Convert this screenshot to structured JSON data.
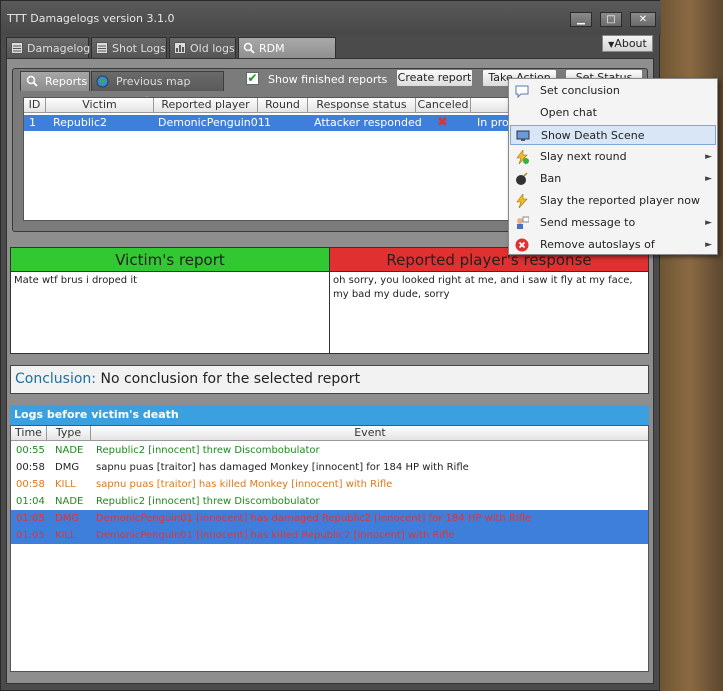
{
  "window": {
    "title": "TTT Damagelogs version 3.1.0",
    "about_label": "About",
    "min_glyph": "▁",
    "max_glyph": "□",
    "close_glyph": "✕"
  },
  "main_tabs": [
    {
      "label": "Damagelog",
      "icon": "list-icon"
    },
    {
      "label": "Shot Logs",
      "icon": "list-icon"
    },
    {
      "label": "Old logs",
      "icon": "chart-icon"
    },
    {
      "label": "RDM Manager",
      "icon": "search-icon",
      "active": true
    }
  ],
  "report_tabs": [
    {
      "label": "Reports",
      "icon": "search-icon",
      "active": true
    },
    {
      "label": "Previous map reports",
      "icon": "globe-icon"
    }
  ],
  "show_finished": {
    "checked": true,
    "check_glyph": "✔",
    "label": "Show finished reports"
  },
  "buttons": {
    "create_report": "Create report",
    "take_action": "Take Action",
    "set_status": "Set Status"
  },
  "reports_table": {
    "columns": [
      "ID",
      "Victim",
      "Reported player",
      "Round",
      "Response status",
      "Canceled",
      "Status"
    ],
    "rows": [
      {
        "id": "1",
        "victim": "Republic2",
        "reported": "DemonicPenguin01",
        "round": "1",
        "response": "Attacker responded",
        "canceled_glyph": "✖",
        "status": "In pro"
      }
    ]
  },
  "victim_report": {
    "title": "Victim's report",
    "text": "Mate wtf brus i droped it"
  },
  "reported_response": {
    "title": "Reported player's response",
    "text": "oh sorry, you looked right at me, and i saw it fly at my face, my bad my dude, sorry"
  },
  "conclusion": {
    "label": "Conclusion:",
    "text": "No conclusion for the selected report"
  },
  "logs": {
    "title": "Logs before victim's death",
    "columns": [
      "Time",
      "Type",
      "Event"
    ],
    "rows": [
      {
        "time": "00:55",
        "type": "NADE",
        "event": "Republic2 [innocent] threw Discombobulator",
        "color": "#1e8a1e",
        "highlight": false
      },
      {
        "time": "00:58",
        "type": "DMG",
        "event": "sapnu puas [traitor] has damaged Monkey [innocent] for 184 HP with Rifle",
        "color": "#222222",
        "highlight": false
      },
      {
        "time": "00:58",
        "type": "KILL",
        "event": "sapnu puas [traitor] has killed Monkey [innocent] with Rifle",
        "color": "#e07818",
        "highlight": false
      },
      {
        "time": "01:04",
        "type": "NADE",
        "event": "Republic2 [innocent] threw Discombobulator",
        "color": "#1e8a1e",
        "highlight": false
      },
      {
        "time": "01:05",
        "type": "DMG",
        "event": "DemonicPenguin01 [innocent] has damaged Republic2 [innocent] for 184 HP with Rifle",
        "color": "#e83030",
        "highlight": true
      },
      {
        "time": "01:05",
        "type": "KILL",
        "event": "DemonicPenguin01 [innocent] has killed Republic2 [innocent] with Rifle",
        "color": "#e83030",
        "highlight": true
      }
    ]
  },
  "context_menu": {
    "arrow_glyph": "►",
    "items": [
      {
        "label": "Set conclusion",
        "icon": "comment-icon",
        "submenu": false
      },
      {
        "label": "Open chat",
        "icon": "chat-icon",
        "submenu": false
      },
      {
        "label": "Show Death Scene",
        "icon": "monitor-icon",
        "submenu": false,
        "highlighted": true
      },
      {
        "label": "Slay next round",
        "icon": "lightning-add-icon",
        "submenu": true
      },
      {
        "label": "Ban",
        "icon": "bomb-icon",
        "submenu": true
      },
      {
        "label": "Slay the reported player now",
        "icon": "lightning-icon",
        "submenu": false
      },
      {
        "label": "Send message to",
        "icon": "user-comment-icon",
        "submenu": true
      },
      {
        "label": "Remove autoslays of",
        "icon": "cancel-icon",
        "submenu": true
      }
    ]
  },
  "colors": {
    "selected_row": "#3f7fdc",
    "victim_header": "#32c832",
    "reported_header": "#e03030",
    "logs_header": "#3aa0e0",
    "cancel_x": "#e03030"
  }
}
